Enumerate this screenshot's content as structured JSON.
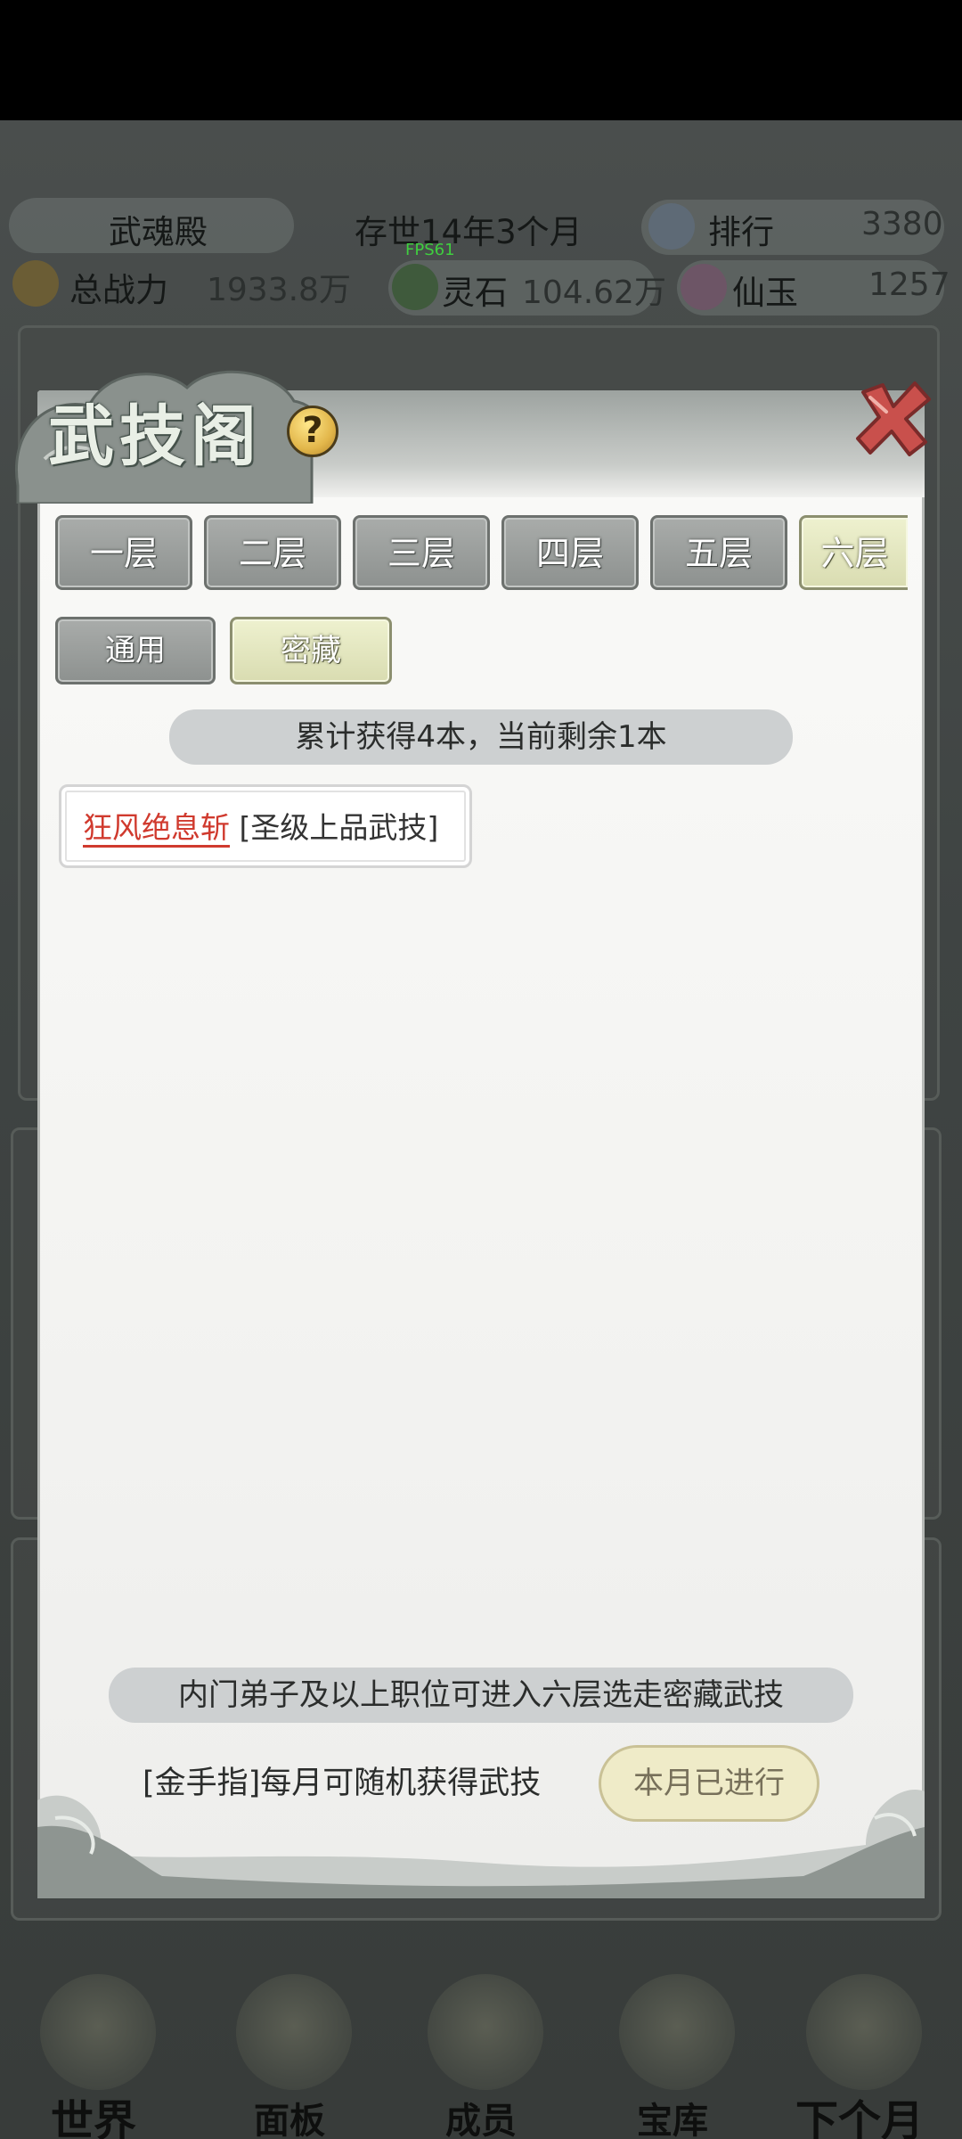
{
  "header": {
    "sect_name": "武魂殿",
    "time_label": "存世14年3个月",
    "rank_label": "排行",
    "rank_value": "3380",
    "power_label": "总战力",
    "power_value": "1933.8万",
    "spirit_stone_label": "灵石",
    "spirit_stone_value": "104.62万",
    "jade_label": "仙玉",
    "jade_value": "1257",
    "fps": "FPS61"
  },
  "modal": {
    "title": "武技阁",
    "help": "?",
    "floors": [
      "一层",
      "二层",
      "三层",
      "四层",
      "五层",
      "六层"
    ],
    "active_floor_index": 5,
    "categories": [
      "通用",
      "密藏"
    ],
    "active_category_index": 1,
    "counter_text": "累计获得4本，当前剩余1本",
    "skill": {
      "name": "狂风绝息斩",
      "grade": "[圣级上品武技]"
    },
    "rule_text": "内门弟子及以上职位可进入六层选走密藏武技",
    "golden_finger_text": "[金手指]每月可随机获得武技",
    "month_button": "本月已进行"
  },
  "bottom_nav": {
    "items": [
      "世界",
      "面板",
      "成员",
      "宝库",
      "下个月"
    ]
  },
  "colors": {
    "skill_name": "#d03a2e",
    "active_tab": "#e5e8c0",
    "inactive_tab": "#9c9f9d"
  }
}
